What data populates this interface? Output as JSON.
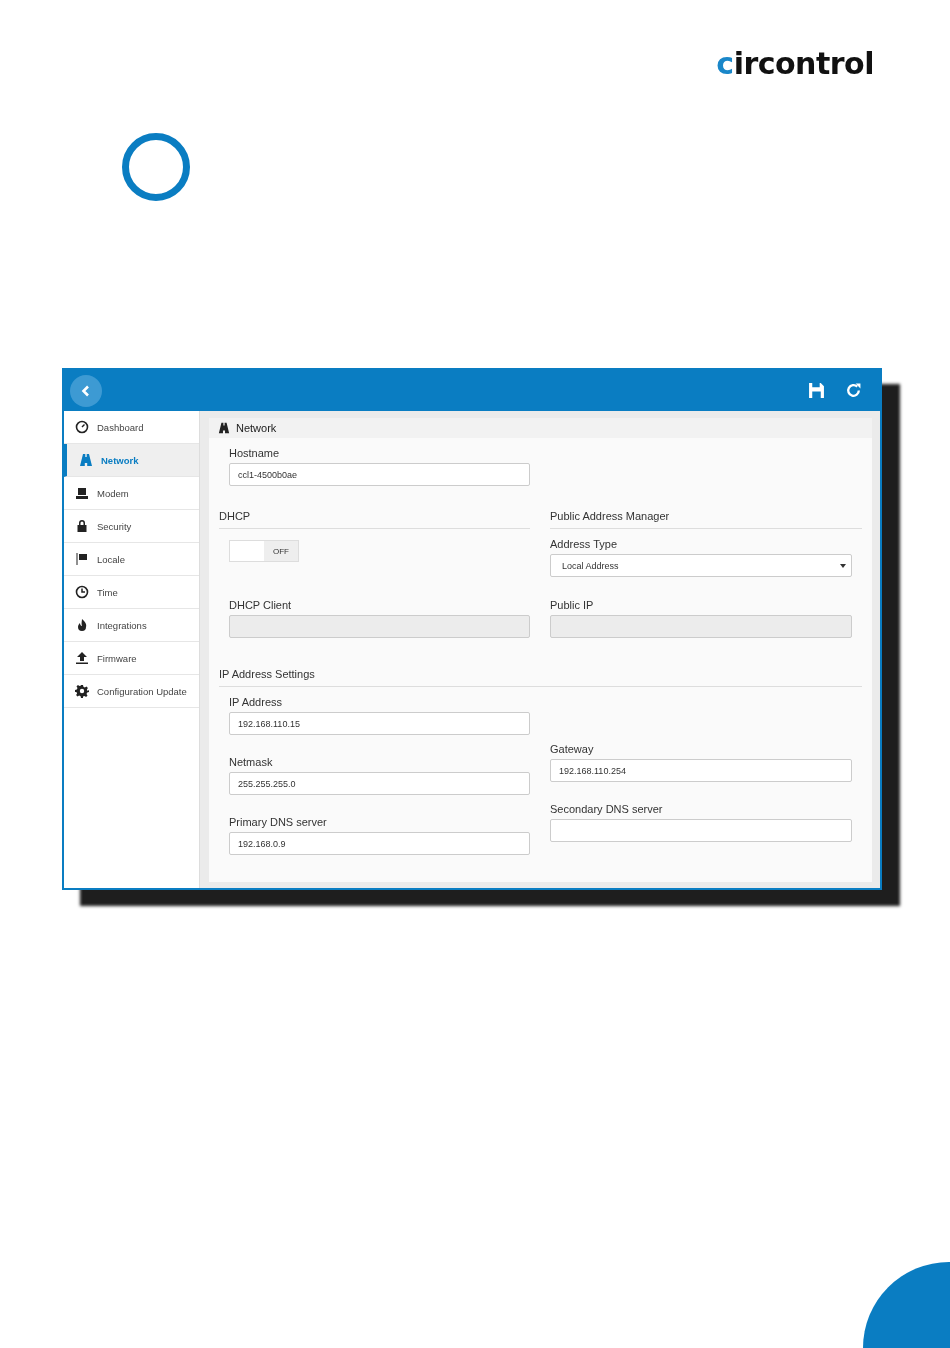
{
  "logo": {
    "text": "circontrol"
  },
  "app": {
    "sidebar": [
      {
        "label": "Dashboard",
        "selected": false
      },
      {
        "label": "Network",
        "selected": true
      },
      {
        "label": "Modem",
        "selected": false
      },
      {
        "label": "Security",
        "selected": false
      },
      {
        "label": "Locale",
        "selected": false
      },
      {
        "label": "Time",
        "selected": false
      },
      {
        "label": "Integrations",
        "selected": false
      },
      {
        "label": "Firmware",
        "selected": false
      },
      {
        "label": "Configuration Update",
        "selected": false
      }
    ],
    "panel_title": "Network",
    "hostname": {
      "label": "Hostname",
      "value": "ccl1-4500b0ae"
    },
    "dhcp": {
      "heading": "DHCP",
      "switch_label": "OFF",
      "on": false,
      "client": {
        "label": "DHCP Client",
        "disabled": true
      }
    },
    "public": {
      "heading": "Public Address Manager",
      "address_type": {
        "label": "Address Type",
        "value": "Local Address"
      },
      "public_ip": {
        "label": "Public IP",
        "disabled": true
      }
    },
    "ip_settings": {
      "heading": "IP Address Settings",
      "ip": {
        "label": "IP Address",
        "value": "192.168.110.15"
      },
      "netmask": {
        "label": "Netmask",
        "value": "255.255.255.0"
      },
      "gateway": {
        "label": "Gateway",
        "value": "192.168.110.254"
      },
      "dns1": {
        "label": "Primary DNS server",
        "value": "192.168.0.9"
      },
      "dns2": {
        "label": "Secondary DNS server"
      }
    }
  }
}
